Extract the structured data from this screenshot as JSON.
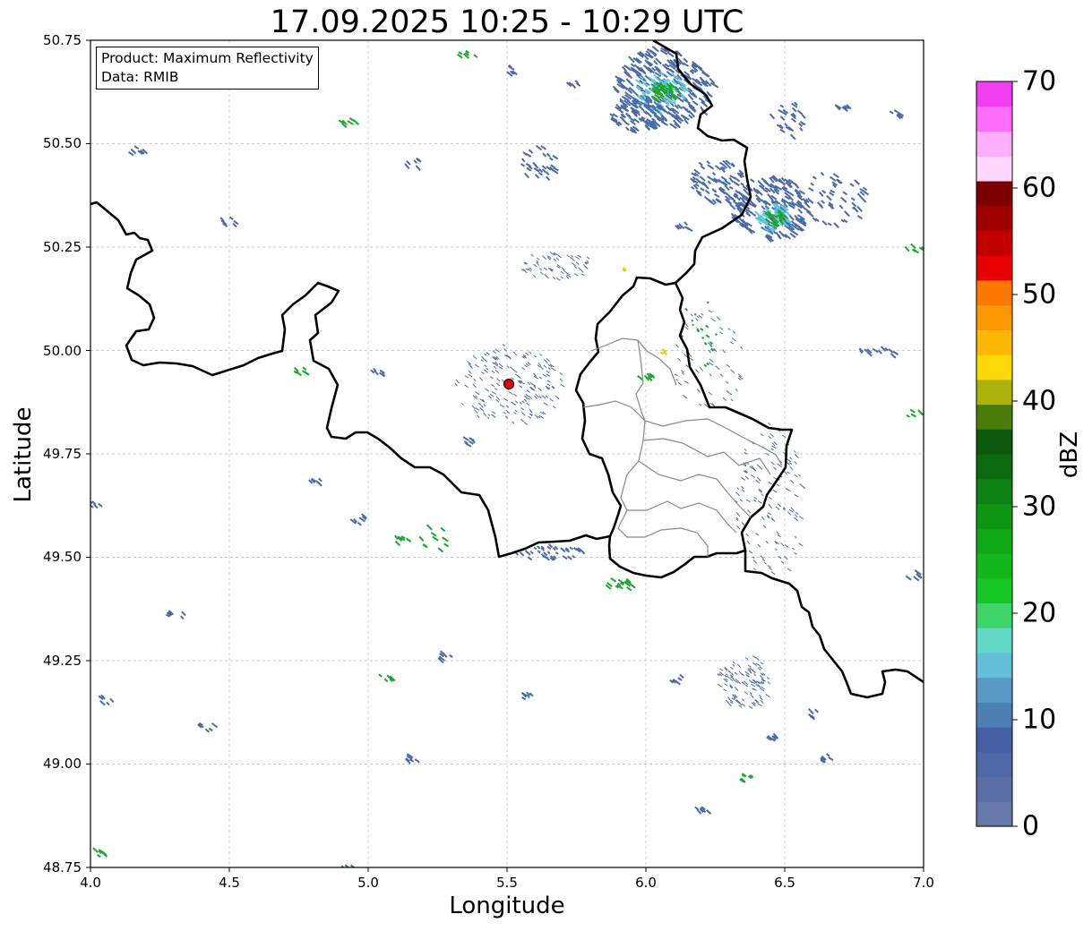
{
  "title": "17.09.2025 10:25 - 10:29 UTC",
  "info": {
    "product": "Product: Maximum Reflectivity",
    "data": "Data: RMIB"
  },
  "axes": {
    "xlabel": "Longitude",
    "ylabel": "Latitude",
    "xticks": [
      "4.0",
      "4.5",
      "5.0",
      "5.5",
      "6.0",
      "6.5",
      "7.0"
    ],
    "yticks": [
      "50.75",
      "50.50",
      "50.25",
      "50.00",
      "49.75",
      "49.50",
      "49.25",
      "49.00",
      "48.75"
    ]
  },
  "colorbar": {
    "label": "dBZ",
    "ticks": [
      "0",
      "10",
      "20",
      "30",
      "40",
      "50",
      "60",
      "70"
    ],
    "colors": [
      "#6677aa",
      "#5b70a6",
      "#4f68a8",
      "#4660a6",
      "#4d7fb4",
      "#5899c4",
      "#63bfd8",
      "#64d8c6",
      "#3dd46a",
      "#15c624",
      "#12b71c",
      "#10a816",
      "#0e9513",
      "#0d8112",
      "#0b6a0f",
      "#0b570b",
      "#497c09",
      "#acb20a",
      "#fdd807",
      "#fdb705",
      "#fd9702",
      "#fd7802",
      "#e60000",
      "#c20000",
      "#a00000",
      "#7c0000",
      "#ffd7ff",
      "#ffadff",
      "#ff6dfd",
      "#f03ff0"
    ]
  },
  "map": {
    "lon_range": [
      4.0,
      7.0
    ],
    "lat_range": [
      48.75,
      50.75
    ],
    "radar_site": {
      "lon": 5.505,
      "lat": 49.915,
      "color": "#e00000"
    },
    "grid": true,
    "echo_colors": {
      "light": "#4a6aa8",
      "cyan": "#5cc8d8",
      "green": "#1aa82a",
      "yellow": "#e8c800"
    }
  }
}
